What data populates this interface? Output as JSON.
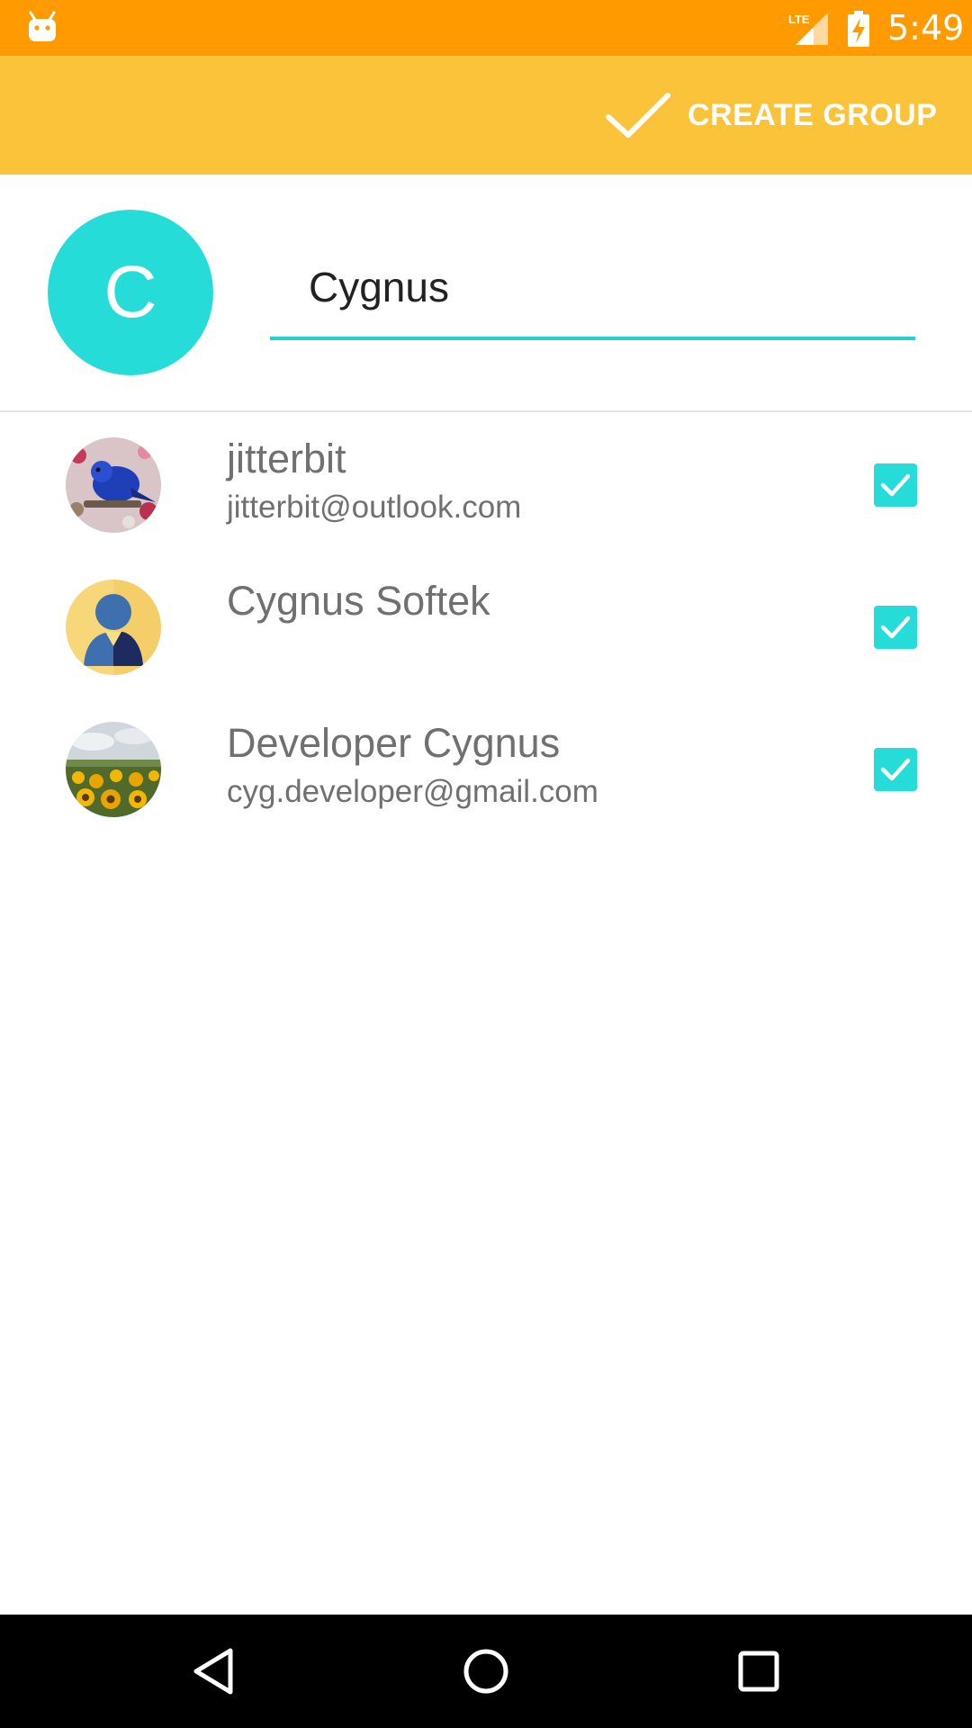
{
  "status_bar": {
    "time": "5:49",
    "network_label": "LTE",
    "icons": [
      "android-debug-icon",
      "lte-signal-icon",
      "battery-charging-icon"
    ]
  },
  "toolbar": {
    "action_label": "CREATE GROUP",
    "action_icon": "check-icon"
  },
  "group": {
    "avatar_letter": "C",
    "avatar_color": "#25DCD8",
    "name_value": "Cygnus"
  },
  "contacts": [
    {
      "name": "jitterbit",
      "email": "jitterbit@outlook.com",
      "checked": true,
      "avatar": "bluebird-photo"
    },
    {
      "name": "Cygnus Softek",
      "email": "",
      "checked": true,
      "avatar": "default-person-avatar"
    },
    {
      "name": "Developer Cygnus",
      "email": "cyg.developer@gmail.com",
      "checked": true,
      "avatar": "sunflower-field-photo"
    }
  ],
  "nav_bar": {
    "icons": [
      "back-icon",
      "home-icon",
      "recents-icon"
    ]
  },
  "colors": {
    "status_bar": "#FF9A00",
    "toolbar": "#FBC33A",
    "accent": "#25DCD8",
    "text_secondary": "#707070"
  }
}
